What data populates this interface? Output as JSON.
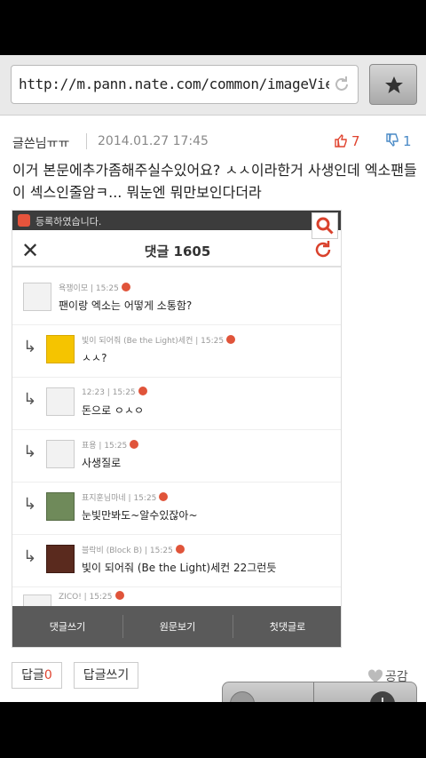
{
  "browser": {
    "url": "http://m.pann.nate.com/common/imageView"
  },
  "comment": {
    "author": "글쓴님ㅠㅠ",
    "date": "2014.01.27 17:45",
    "upvotes": "7",
    "downvotes": "1",
    "body": "이거 본문에추가좀해주실수있어요? ㅅㅅ이라한거 사생인데 엑소팬들이 섹스인줄암ㅋ... 뭐눈엔 뭐만보인다더라"
  },
  "screenshot": {
    "notification": "등록하였습니다.",
    "title": "댓글 1605",
    "comments": [
      {
        "author": "욕쟁이모",
        "time": "15:25",
        "text": "팬이랑 엑소는 어떻게 소통함?"
      },
      {
        "author": "빛이 되어줘 (Be the Light)세컨",
        "time": "15:25",
        "text": "ㅅㅅ?"
      },
      {
        "author": "12:23",
        "time": "15:25",
        "text": "돈으로 ㅇㅅㅇ"
      },
      {
        "author": "표용",
        "time": "15:25",
        "text": "사생질로"
      },
      {
        "author": "표지훈님마네",
        "time": "15:25",
        "text": "눈빛만봐도~알수있잖아~"
      },
      {
        "author": "블락비 (Block B)",
        "time": "15:25",
        "text": "빛이 되어줘 (Be the Light)세컨 22그런듯"
      },
      {
        "author": "ZICO!",
        "time": "15:25",
        "text": ""
      }
    ],
    "bottom_buttons": [
      "댓글쓰기",
      "원문보기",
      "첫댓글로"
    ]
  },
  "actions": {
    "reply_label": "답글",
    "reply_count": "0",
    "write_reply_label": "답글쓰기",
    "like_label": "공감"
  }
}
